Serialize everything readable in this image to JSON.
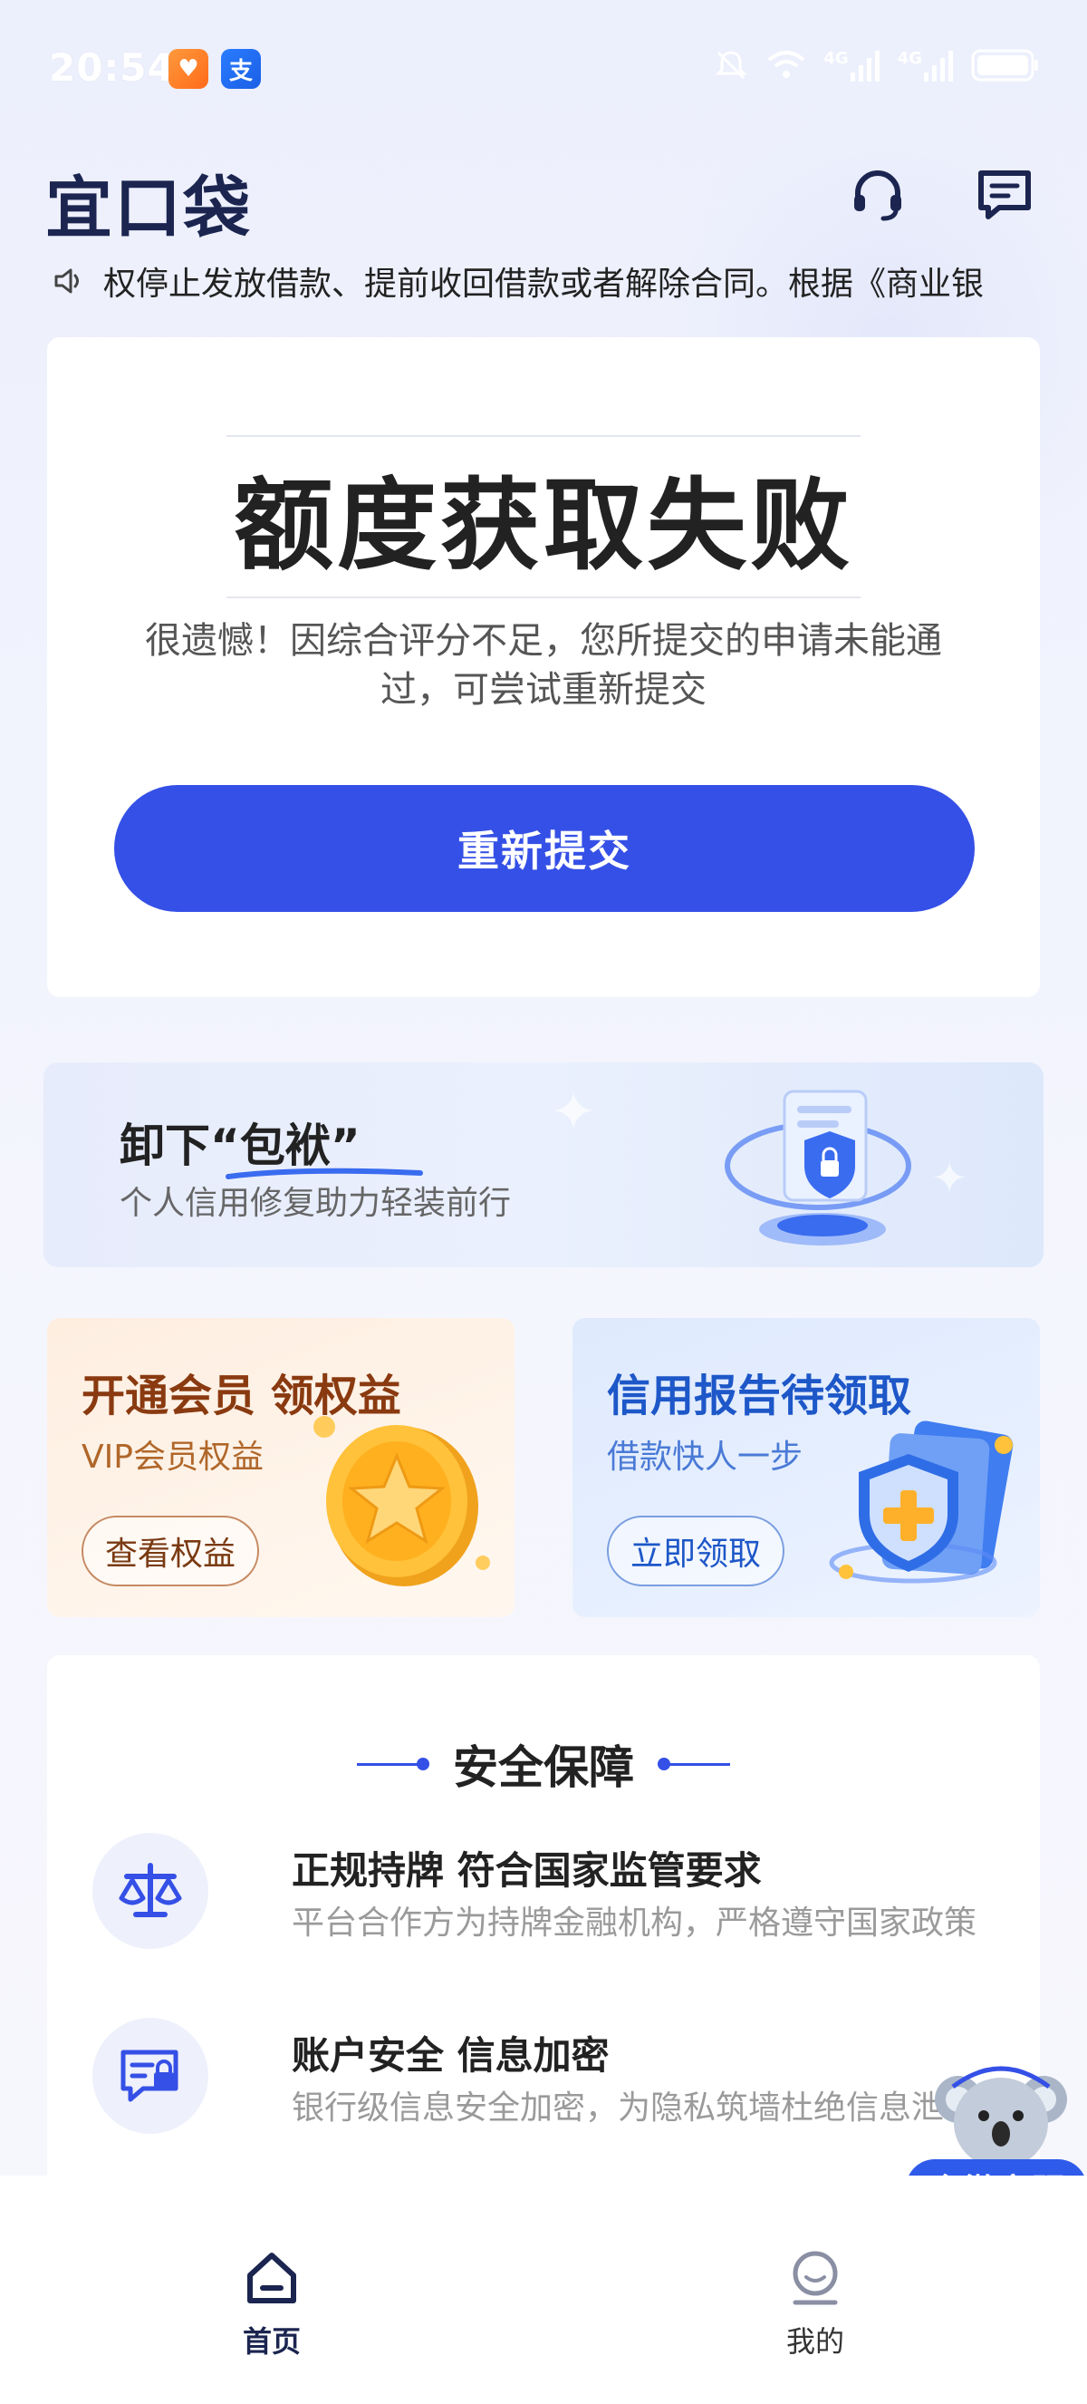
{
  "status_bar": {
    "time": "20:54",
    "badge_1_label": "♥",
    "badge_2_label": "支",
    "network_1": "4G",
    "network_2": "4G"
  },
  "header": {
    "logo_text": "宜口袋"
  },
  "marquee": {
    "text": "权停止发放借款、提前收回借款或者解除合同。根据《商业银"
  },
  "result": {
    "title": "额度获取失败",
    "description": "很遗憾！因综合评分不足，您所提交的申请未能通过，可尝试重新提交",
    "button_label": "重新提交"
  },
  "repair_banner": {
    "title": "卸下“包袱”",
    "subtitle": "个人信用修复助力轻装前行"
  },
  "promo_vip": {
    "title": "开通会员 领权益",
    "subtitle": "VIP会员权益",
    "button_label": "查看权益"
  },
  "promo_credit": {
    "title": "信用报告待领取",
    "subtitle": "借款快人一步",
    "button_label": "立即领取"
  },
  "security": {
    "heading": "安全保障",
    "items": [
      {
        "title": "正规持牌 符合国家监管要求",
        "desc": "平台合作方为持牌金融机构，严格遵守国家政策"
      },
      {
        "title": "账户安全 信息加密",
        "desc": "银行级信息安全加密，为隐私筑墙杜绝信息泄"
      }
    ]
  },
  "float_service": {
    "label": "企微客服"
  },
  "bottom_nav": {
    "home_label": "首页",
    "mine_label": "我的"
  },
  "colors": {
    "primary": "#3550e6",
    "logo": "#1b2550",
    "vip_title": "#8a3a10",
    "credit_title": "#1d57c8"
  },
  "icons": [
    "mute-icon",
    "wifi-icon",
    "signal-icon",
    "battery-icon",
    "headset-icon",
    "message-icon",
    "speaker-icon",
    "scale-icon",
    "chat-lock-icon",
    "home-icon",
    "user-icon"
  ]
}
